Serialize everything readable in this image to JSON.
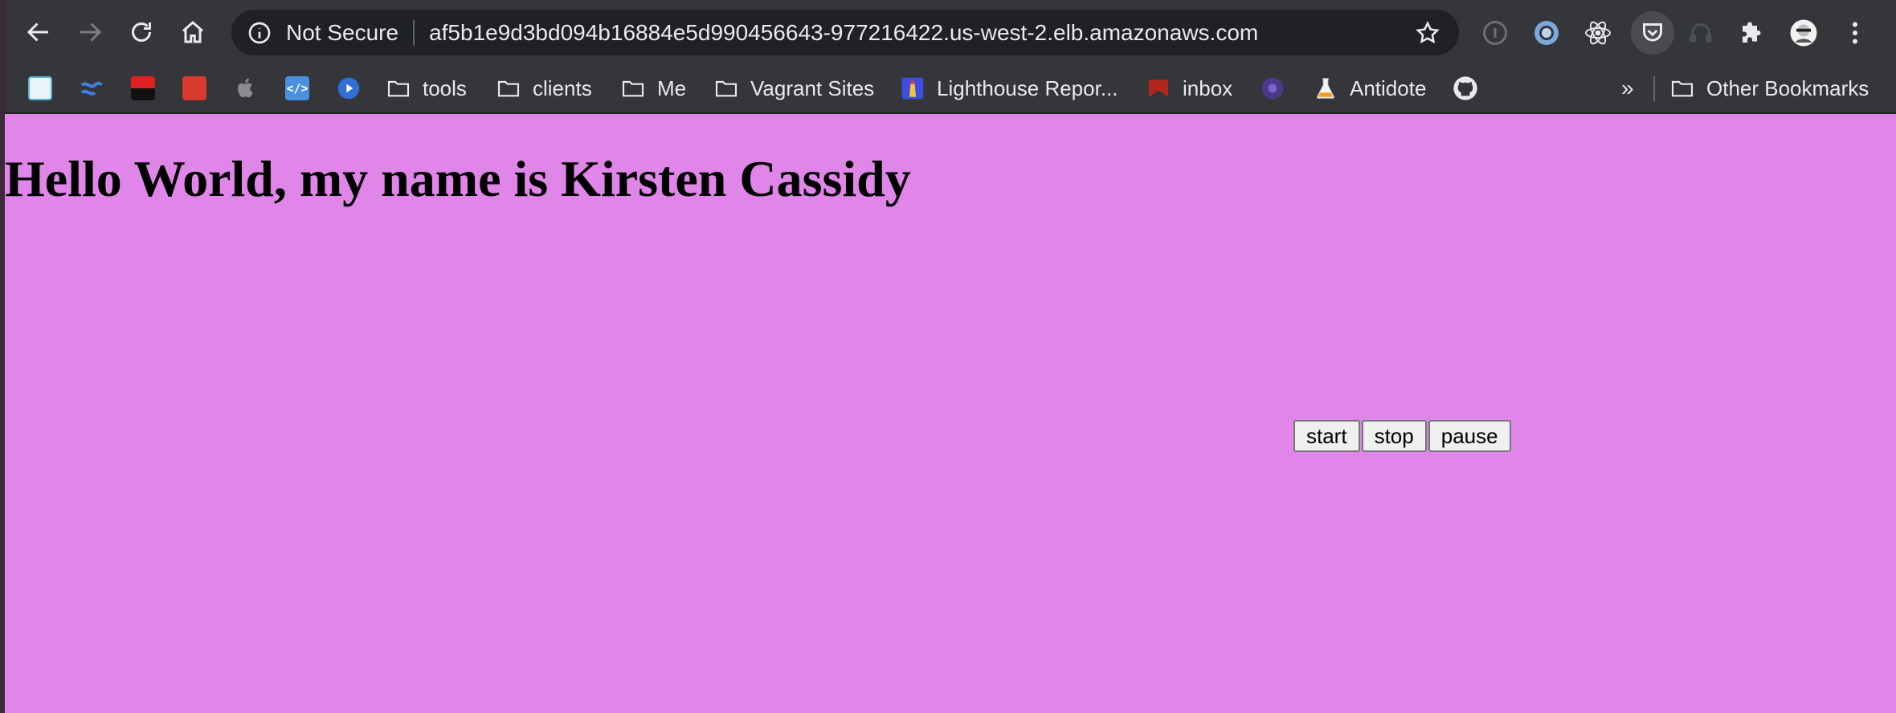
{
  "browser": {
    "omnibox": {
      "security_label": "Not Secure",
      "url": "af5b1e9d3bd094b16884e5d990456643-977216422.us-west-2.elb.amazonaws.com"
    },
    "bookmarks": {
      "folders": [
        {
          "label": "tools"
        },
        {
          "label": "clients"
        },
        {
          "label": "Me"
        },
        {
          "label": "Vagrant Sites"
        }
      ],
      "links": [
        {
          "label": "Lighthouse Repor..."
        },
        {
          "label": "inbox"
        },
        {
          "label": "Antidote"
        }
      ],
      "overflow": "»",
      "other_bookmarks": "Other Bookmarks"
    },
    "colors": {
      "toolbar_bg": "#35363a",
      "omnibox_bg": "#202124",
      "text": "#e8eaed"
    }
  },
  "page": {
    "background": "#df86e8",
    "heading": "Hello World, my name is Kirsten Cassidy",
    "controls": {
      "start": "start",
      "stop": "stop",
      "pause": "pause"
    }
  }
}
